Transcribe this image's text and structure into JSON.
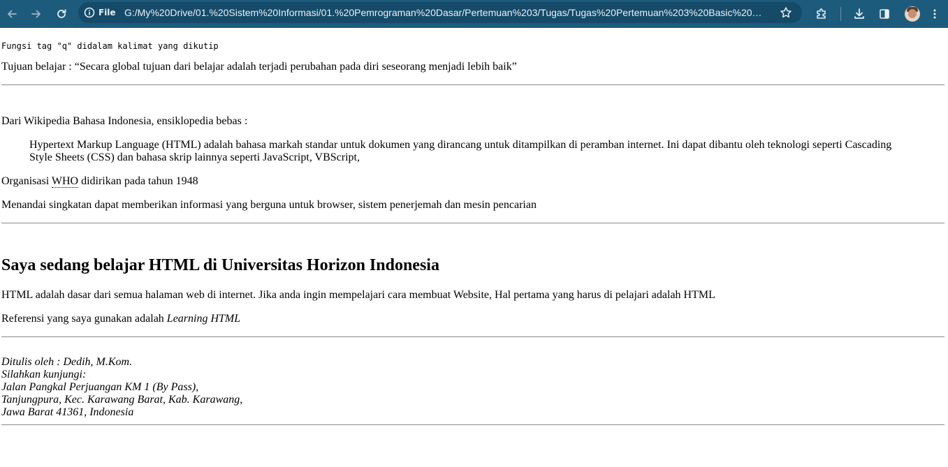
{
  "browser": {
    "info_chip_label": "File",
    "url": "G:/My%20Drive/01.%20Sistem%20Informasi/01.%20Pemrograman%20Dasar/Pertemuan%203/Tugas/Tugas%20Pertemuan%203%20Basic%20Progra..."
  },
  "content": {
    "q_heading": "Fungsi tag \"q\" didalam kalimat yang dikutip",
    "q_prefix": "Tujuan belajar : ",
    "q_text": "Secara global tujuan dari belajar adalah terjadi perubahan pada diri seseorang menjadi lebih baik",
    "wiki_intro": "Dari Wikipedia Bahasa Indonesia, ensiklopedia bebas :",
    "blockquote_text": "Hypertext Markup Language (HTML) adalah bahasa markah standar untuk dokumen yang dirancang untuk ditampilkan di peramban internet. Ini dapat dibantu oleh teknologi seperti Cascading Style Sheets (CSS) dan bahasa skrip lainnya seperti JavaScript, VBScript,",
    "org_prefix": "Organisasi ",
    "org_abbr": "WHO",
    "org_suffix": " didirikan pada tahun 1948",
    "abbr_note": "Menandai singkatan dapat memberikan informasi yang berguna untuk browser, sistem penerjemah dan mesin pencarian",
    "heading": "Saya sedang belajar HTML di Universitas Horizon Indonesia",
    "html_paragraph": "HTML adalah dasar dari semua halaman web di internet. Jika anda ingin mempelajari cara membuat Website, Hal pertama yang harus di pelajari adalah HTML",
    "ref_prefix": "Referensi yang saya gunakan adalah ",
    "ref_cite": "Learning HTML",
    "address_lines": [
      "Ditulis oleh : Dedih, M.Kom.",
      "Silahkan kunjungi:",
      "Jalan Pangkal Perjuangan KM 1 (By Pass),",
      "Tanjungpura, Kec. Karawang Barat, Kab. Karawang,",
      "Jawa Barat 41361, Indonesia"
    ]
  },
  "icons": [
    "arrow-left-icon",
    "arrow-right-icon",
    "reload-icon",
    "info-icon",
    "star-icon",
    "extensions-icon",
    "download-icon",
    "side-panel-icon",
    "avatar",
    "more-vert-icon"
  ]
}
